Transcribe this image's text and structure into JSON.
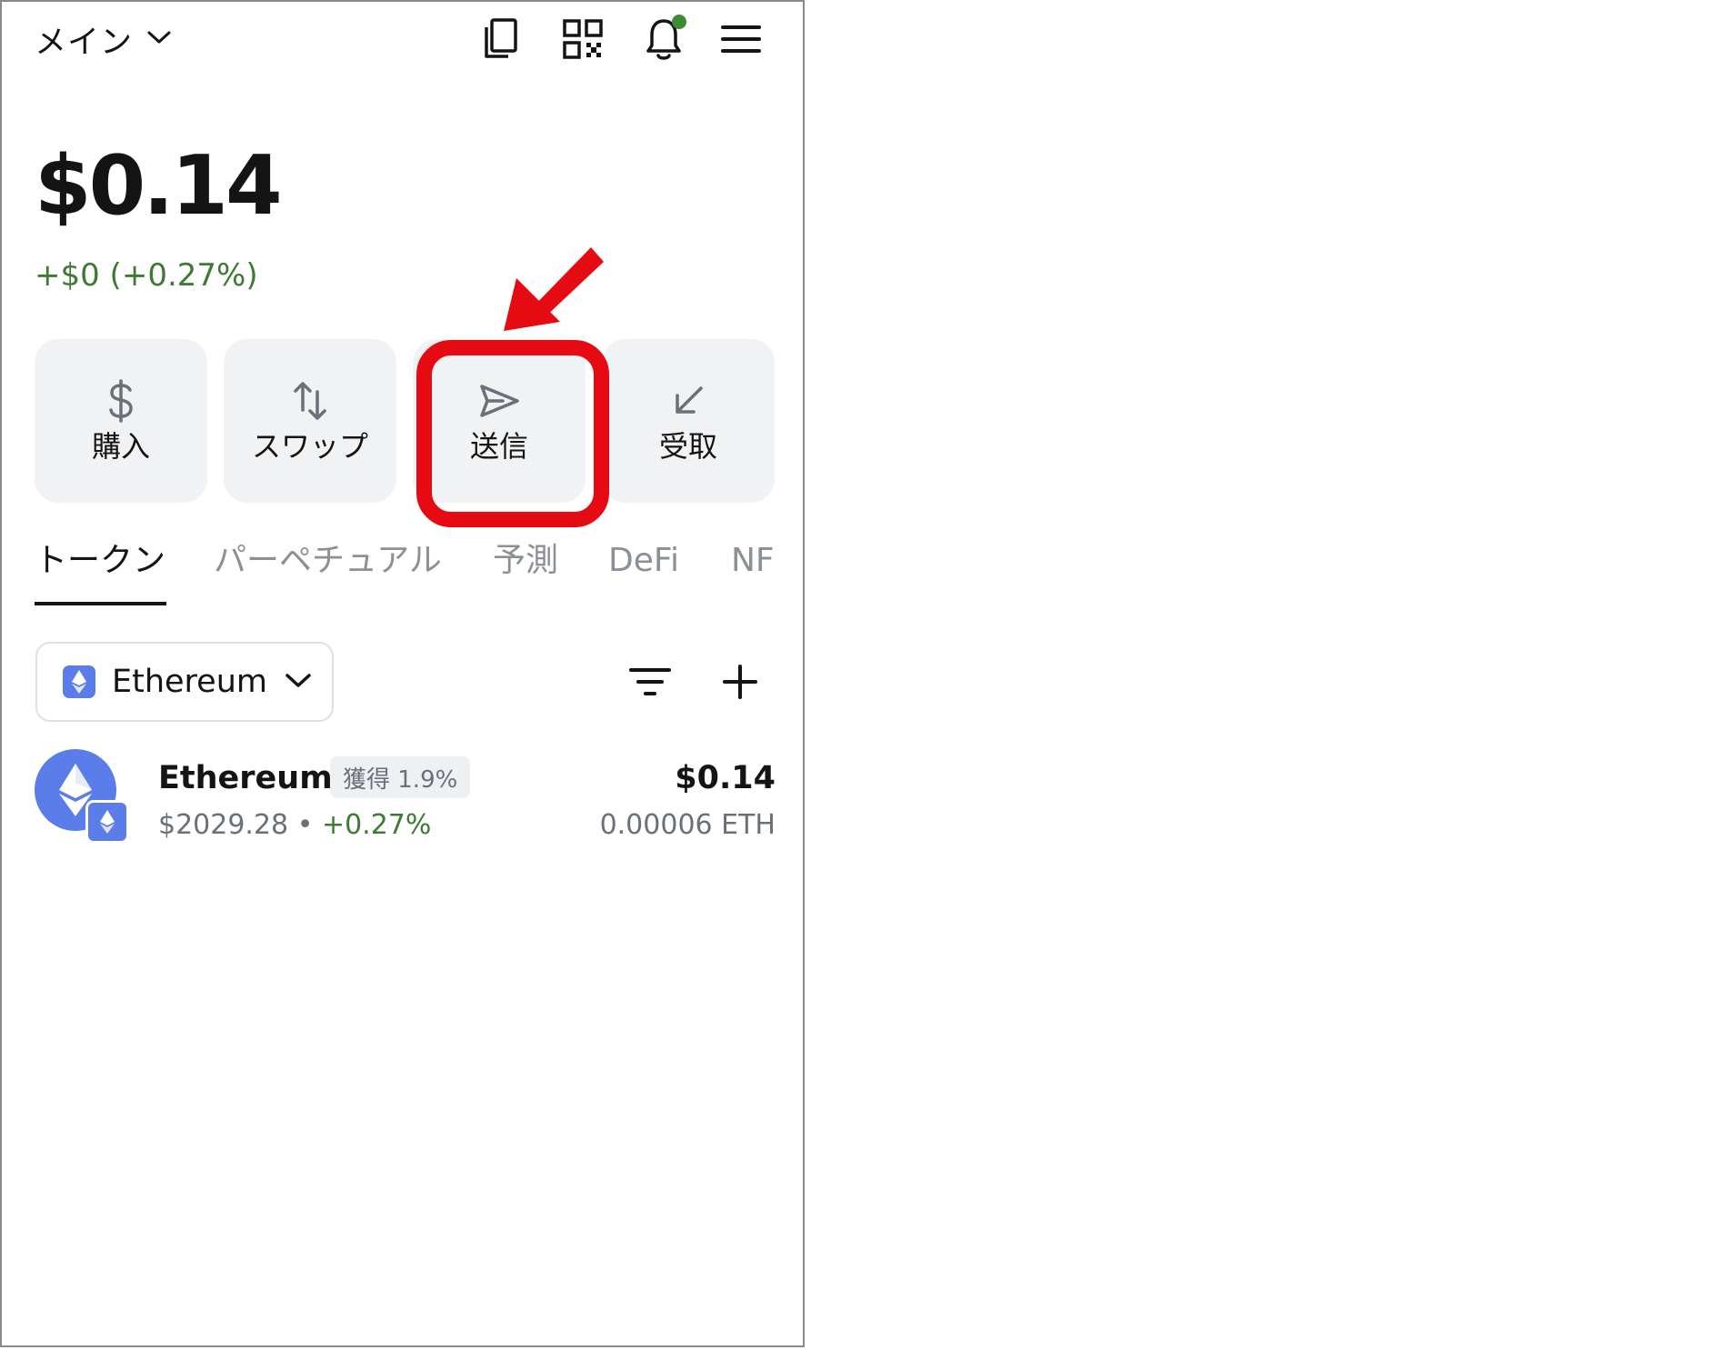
{
  "header": {
    "account_name": "メイン",
    "icons": [
      "chevron-down-icon",
      "copy-icon",
      "qr-code-icon",
      "bell-icon",
      "menu-icon"
    ]
  },
  "balance": {
    "total": "$0.14",
    "change": "+$0 (+0.27%)"
  },
  "actions": [
    {
      "label": "購入",
      "icon": "dollar-icon"
    },
    {
      "label": "スワップ",
      "icon": "swap-icon"
    },
    {
      "label": "送信",
      "icon": "send-icon"
    },
    {
      "label": "受取",
      "icon": "receive-icon"
    }
  ],
  "tabs": [
    {
      "label": "トークン",
      "active": true
    },
    {
      "label": "パーペチュアル",
      "active": false
    },
    {
      "label": "予測",
      "active": false
    },
    {
      "label": "DeFi",
      "active": false
    },
    {
      "label": "NF",
      "active": false
    }
  ],
  "network_selector": {
    "label": "Ethereum"
  },
  "tokens": [
    {
      "name": "Ethereum",
      "earn_badge": "獲得 1.9%",
      "price": "$2029.28",
      "separator": "•",
      "price_change": "+0.27%",
      "value": "$0.14",
      "amount": "0.00006 ETH"
    }
  ],
  "colors": {
    "positive": "#3d7a32",
    "highlight": "#e60b12",
    "notification_dot": "#3d8b37",
    "ethereum": "#5b7de9",
    "action_bg": "#f1f2f4"
  }
}
